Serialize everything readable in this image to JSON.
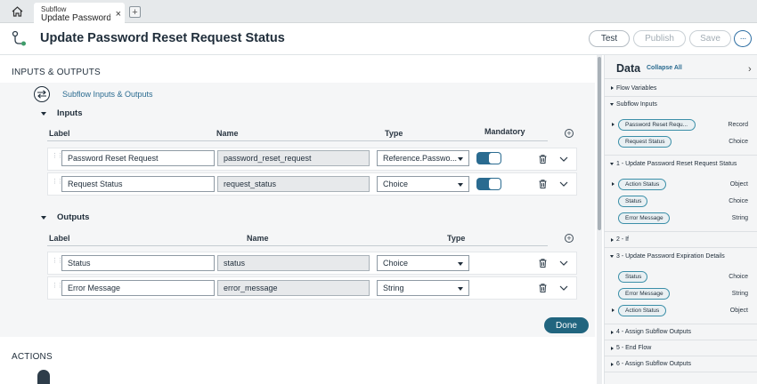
{
  "tab": {
    "kind": "Subflow",
    "title": "Update Password R...",
    "close": "×",
    "add": "+"
  },
  "header": {
    "title": "Update Password Reset Request Status",
    "test": "Test",
    "publish": "Publish",
    "save": "Save",
    "more": "···"
  },
  "sections": {
    "inputs_outputs": "INPUTS & OUTPUTS",
    "link": "Subflow Inputs & Outputs",
    "actions": "ACTIONS"
  },
  "inputs": {
    "title": "Inputs",
    "headers": {
      "label": "Label",
      "name": "Name",
      "type": "Type",
      "mandatory": "Mandatory"
    },
    "rows": [
      {
        "label": "Password Reset Request",
        "name": "password_reset_request",
        "type": "Reference.Passwo...",
        "mandatory": true
      },
      {
        "label": "Request Status",
        "name": "request_status",
        "type": "Choice",
        "mandatory": true
      }
    ]
  },
  "outputs": {
    "title": "Outputs",
    "headers": {
      "label": "Label",
      "name": "Name",
      "type": "Type"
    },
    "rows": [
      {
        "label": "Status",
        "name": "status",
        "type": "Choice"
      },
      {
        "label": "Error Message",
        "name": "error_message",
        "type": "String"
      }
    ]
  },
  "done": "Done",
  "data_panel": {
    "title": "Data",
    "collapse_all": "Collapse All",
    "flow_variables": "Flow Variables",
    "subflow_inputs": "Subflow Inputs",
    "subflow_inputs_items": [
      {
        "label": "Password Reset Requ...",
        "type": "Record"
      },
      {
        "label": "Request Status",
        "type": "Choice"
      }
    ],
    "step1": "1 - Update Password Reset Request Status",
    "step1_items": [
      {
        "label": "Action Status",
        "type": "Object"
      },
      {
        "label": "Status",
        "type": "Choice"
      },
      {
        "label": "Error Message",
        "type": "String"
      }
    ],
    "step2": "2 - If",
    "step3": "3 - Update Password Expiration Details",
    "step3_items": [
      {
        "label": "Status",
        "type": "Choice"
      },
      {
        "label": "Error Message",
        "type": "String"
      },
      {
        "label": "Action Status",
        "type": "Object"
      }
    ],
    "step4": "4 - Assign Subflow Outputs",
    "step5": "5 - End Flow",
    "step6": "6 - Assign Subflow Outputs"
  }
}
